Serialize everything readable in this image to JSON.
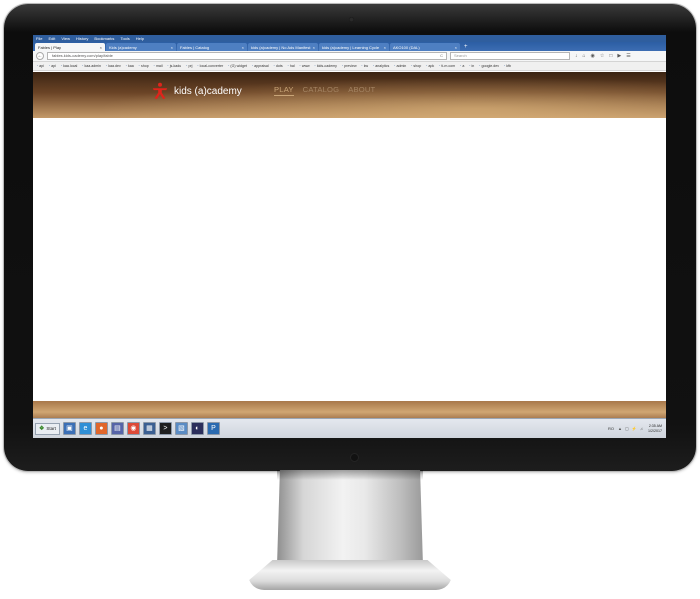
{
  "browser": {
    "menu": [
      "File",
      "Edit",
      "View",
      "History",
      "Bookmarks",
      "Tools",
      "Help"
    ],
    "tabs": [
      {
        "label": "Fables | Play",
        "active": true
      },
      {
        "label": "Kids (a)cademy",
        "active": false
      },
      {
        "label": "Fables | Catalog",
        "active": false
      },
      {
        "label": "kids (a)cademy | No Ads Manifest",
        "active": false
      },
      {
        "label": "kids (a)cademy | Learning Cycle",
        "active": false
      },
      {
        "label": "AKO100 (DAL)",
        "active": false
      }
    ],
    "new_tab": "+",
    "close": "×",
    "url": "fables.kids-cademy.com/play/fable",
    "reload": "C",
    "search_placeholder": "Search",
    "nav_icons": [
      "star-icon",
      "download-icon",
      "home-icon",
      "pocket-icon",
      "sync-icon",
      "menu-icon"
    ],
    "bookmarks": [
      "api",
      "api",
      "kaa.local",
      "kaa.admin",
      "kaa.dev",
      "kaa",
      "shop",
      "mail",
      "js-kadu",
      "prj",
      "local-converter",
      "(G) widget",
      "appraisal",
      "dots",
      "hal",
      "www",
      "kids-cademy",
      "preview",
      "kw",
      "analytics",
      "admin",
      "shop",
      "apk",
      "ti-m.com",
      "a",
      "in",
      "google.dev",
      "kfb"
    ]
  },
  "site": {
    "brand": "kids (a)cademy",
    "nav": [
      {
        "label": "PLAY",
        "active": true
      },
      {
        "label": "CATALOG",
        "active": false
      },
      {
        "label": "ABOUT",
        "active": false
      }
    ]
  },
  "taskbar": {
    "start_label": "Start",
    "apps": [
      {
        "icon": "explorer-icon",
        "color": "#3b6fb6"
      },
      {
        "icon": "ie-icon",
        "color": "#2f8fd6"
      },
      {
        "icon": "firefox-icon",
        "color": "#e0662b"
      },
      {
        "icon": "save-icon",
        "color": "#5664a8"
      },
      {
        "icon": "chrome-icon",
        "color": "#dc4a38"
      },
      {
        "icon": "network-icon",
        "color": "#3b5f92"
      },
      {
        "icon": "terminal-icon",
        "color": "#1f1f1f"
      },
      {
        "icon": "image-icon",
        "color": "#5b8cc4"
      },
      {
        "icon": "eclipse-icon",
        "color": "#2c2f5c"
      },
      {
        "icon": "photoshop-icon",
        "color": "#2a6ab0"
      }
    ],
    "lang": "RO",
    "time": "2:35 AM",
    "date": "1/2/2017"
  }
}
